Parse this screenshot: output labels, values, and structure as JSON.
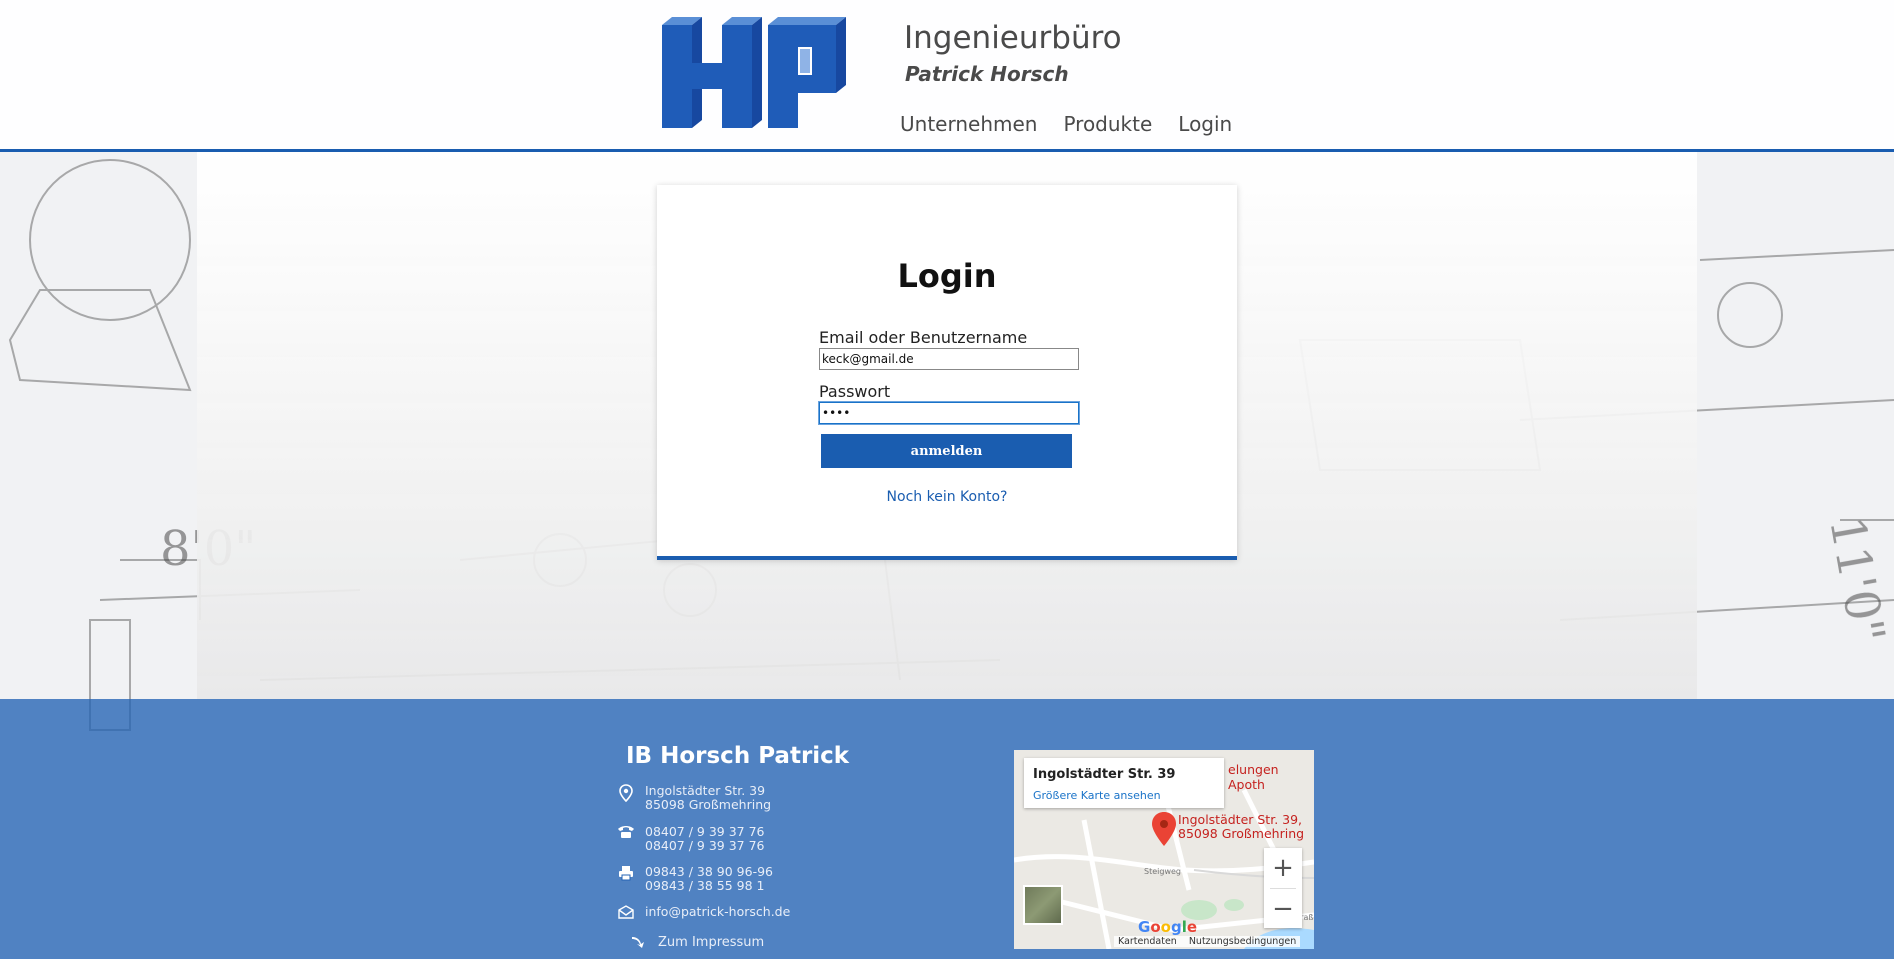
{
  "header": {
    "logo_text": "HP",
    "title": "Ingenieurbüro",
    "subtitle": "Patrick Horsch",
    "nav": [
      {
        "label": "Unternehmen"
      },
      {
        "label": "Produkte"
      },
      {
        "label": "Login"
      }
    ]
  },
  "login": {
    "title": "Login",
    "email_label": "Email oder Benutzername",
    "email_value": "keck@gmail.de",
    "password_label": "Passwort",
    "password_value": "••••",
    "submit_label": "anmelden",
    "register_link": "Noch kein Konto?"
  },
  "footer": {
    "company": "IB Horsch Patrick",
    "address_line1": "Ingolstädter Str. 39",
    "address_line2": "85098 Großmehring",
    "phone1": "08407 / 9 39 37 76",
    "phone2": "08407 / 9 39 37 76",
    "fax1": "09843 / 38 90 96-96",
    "fax2": "09843 / 38 55 98 1",
    "email": "info@patrick-horsch.de",
    "imprint": "Zum Impressum",
    "icons": [
      "location-pin-icon",
      "phone-icon",
      "fax-icon",
      "mail-icon",
      "arrow-right-icon"
    ]
  },
  "map": {
    "card_title": "Ingolstädter Str. 39",
    "card_link": "Größere Karte ansehen",
    "pin_label": "Ingolstädter Str. 39, 85098 Großmehring",
    "nearby_label": "elungen Apoth",
    "google": "Google",
    "attrib_data": "Kartendaten",
    "attrib_terms": "Nutzungsbedingungen",
    "zoom_in": "+",
    "zoom_out": "−"
  },
  "colors": {
    "accent": "#1a5db0",
    "footer_bg": "#2363b4",
    "link": "#1a73c8",
    "map_pin": "#c5221f"
  }
}
